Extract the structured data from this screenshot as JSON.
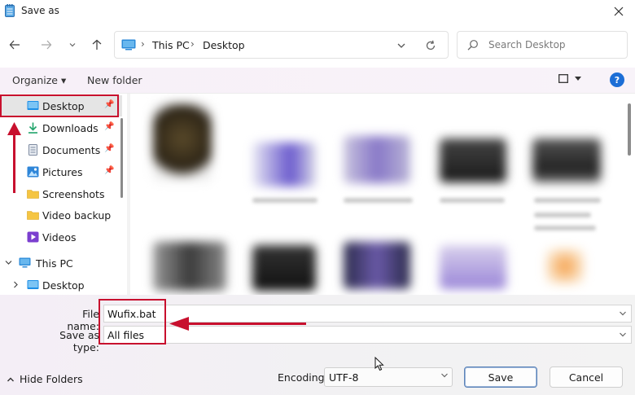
{
  "window": {
    "title": "Save as",
    "close_icon": "close-icon"
  },
  "nav": {
    "back_icon": "arrow-left-icon",
    "forward_icon": "arrow-right-icon",
    "recent_icon": "chevron-down-icon",
    "up_icon": "arrow-up-icon",
    "breadcrumb": [
      "This PC",
      "Desktop"
    ],
    "refresh_icon": "refresh-icon",
    "search_placeholder": "Search Desktop"
  },
  "toolbar": {
    "organize": "Organize ▾",
    "new_folder": "New folder",
    "help": "?"
  },
  "sidebar": {
    "items": [
      {
        "label": "Desktop",
        "icon": "desktop-folder-icon",
        "pinned": true,
        "selected": true
      },
      {
        "label": "Downloads",
        "icon": "download-icon",
        "pinned": true
      },
      {
        "label": "Documents",
        "icon": "document-icon",
        "pinned": true
      },
      {
        "label": "Pictures",
        "icon": "pictures-icon",
        "pinned": true
      },
      {
        "label": "Screenshots",
        "icon": "folder-icon",
        "pinned": false
      },
      {
        "label": "Video backup",
        "icon": "folder-icon",
        "pinned": false
      },
      {
        "label": "Videos",
        "icon": "videos-icon",
        "pinned": false
      },
      {
        "label": "This PC",
        "icon": "pc-icon",
        "pinned": false
      },
      {
        "label": "Desktop",
        "icon": "desktop-folder-icon",
        "pinned": false
      }
    ]
  },
  "form": {
    "file_name_label": "File name:",
    "file_name_value": "Wufix.bat",
    "save_as_type_label": "Save as type:",
    "save_as_type_value": "All files"
  },
  "footer": {
    "hide_folders": "Hide Folders",
    "encoding_label": "Encoding:",
    "encoding_value": "UTF-8",
    "save": "Save",
    "cancel": "Cancel"
  },
  "colors": {
    "accent": "#1c6ed6",
    "annotation": "#c8102e"
  }
}
